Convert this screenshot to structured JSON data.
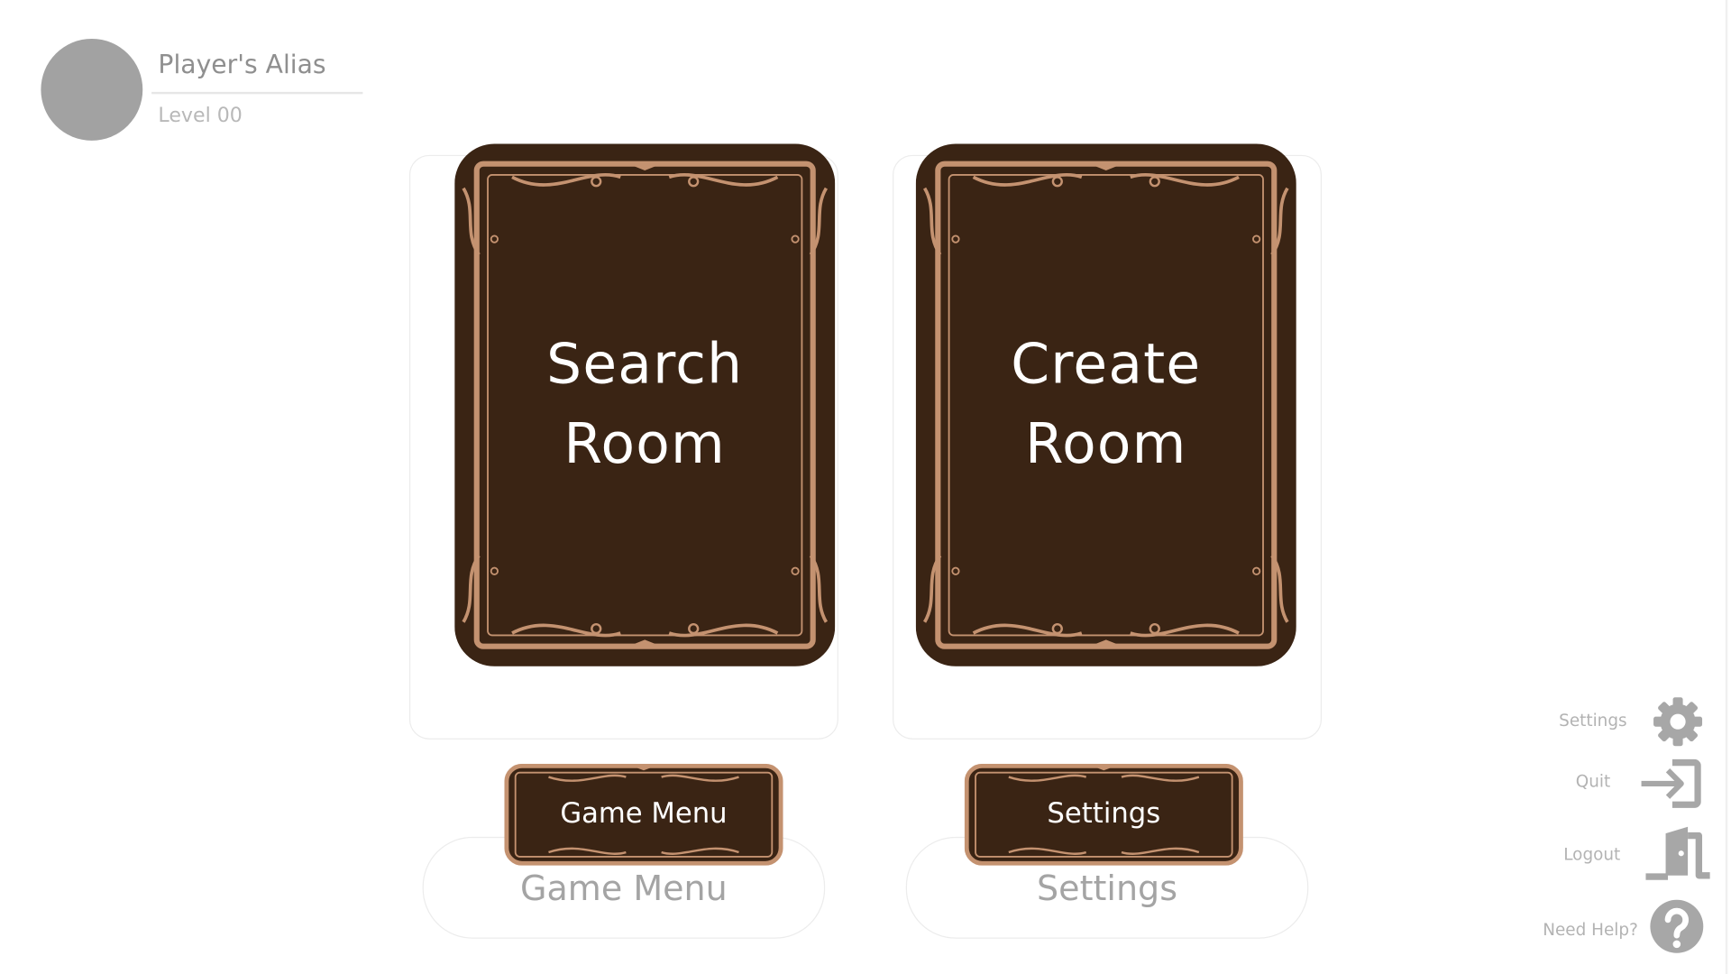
{
  "player": {
    "alias": "Player's Alias",
    "level": "Level 00"
  },
  "cards": {
    "search": {
      "line1": "Search",
      "line2": "Room"
    },
    "create": {
      "line1": "Create",
      "line2": "Room"
    }
  },
  "buttons": {
    "game_menu": "Game Menu",
    "settings": "Settings"
  },
  "placeholders": {
    "game_menu": "Game Menu",
    "settings": "Settings"
  },
  "side_menu": {
    "settings": "Settings",
    "quit": "Quit",
    "logout": "Logout",
    "help": "Need Help?"
  },
  "colors": {
    "card_fill": "#3a2414",
    "card_ornament": "#c49270",
    "icon_gray": "#a7a7a7"
  },
  "icons": {
    "settings": "gear-icon",
    "quit": "exit-arrow-icon",
    "logout": "door-icon",
    "help": "question-circle-icon"
  }
}
